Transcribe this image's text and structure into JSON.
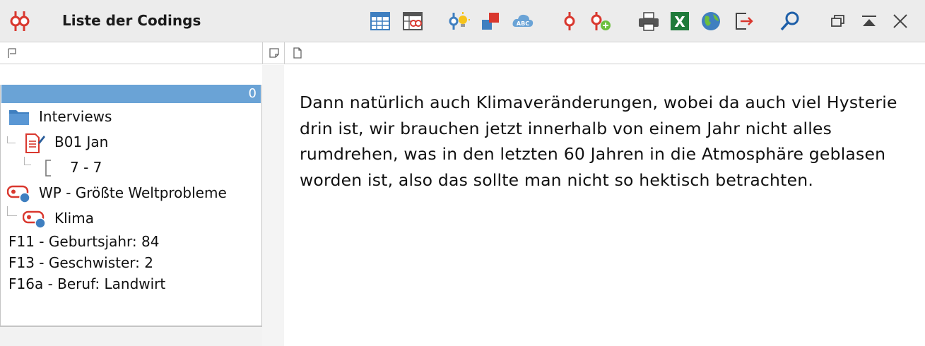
{
  "window": {
    "title": "Liste der Codings"
  },
  "toolbar": {
    "icons": [
      "table-view-icon",
      "code-matrix-icon",
      "code-lightbulb-icon",
      "shapes-icon",
      "cloud-abc-icon",
      "code-icon",
      "add-code-icon",
      "print-icon",
      "excel-icon",
      "globe-icon",
      "export-icon",
      "search-icon",
      "restore-window-icon",
      "collapse-icon",
      "close-icon"
    ]
  },
  "panel": {
    "count": "0",
    "tree": {
      "folder_label": "Interviews",
      "document_label": "B01 Jan",
      "segment_label": "7 - 7",
      "code_label": "WP - Größte Weltprobleme",
      "subcode_label": "Klima"
    },
    "attributes": [
      "F11 - Geburtsjahr: 84",
      "F13 - Geschwister: 2",
      "F16a - Beruf: Landwirt"
    ]
  },
  "segment": {
    "text": "Dann natürlich auch Klimaveränderungen, wobei da auch viel Hysterie drin ist, wir brauchen jetzt innerhalb von einem Jahr nicht alles rumdrehen, was in den letzten 60 Jahren in die Atmosphäre geblasen worden ist, also das sollte man nicht so hektisch betrachten."
  },
  "colors": {
    "accent": "#6aa3d6",
    "code_red": "#d9382f",
    "code_blue": "#3f7fc0",
    "excel_green": "#1f7a3a"
  }
}
